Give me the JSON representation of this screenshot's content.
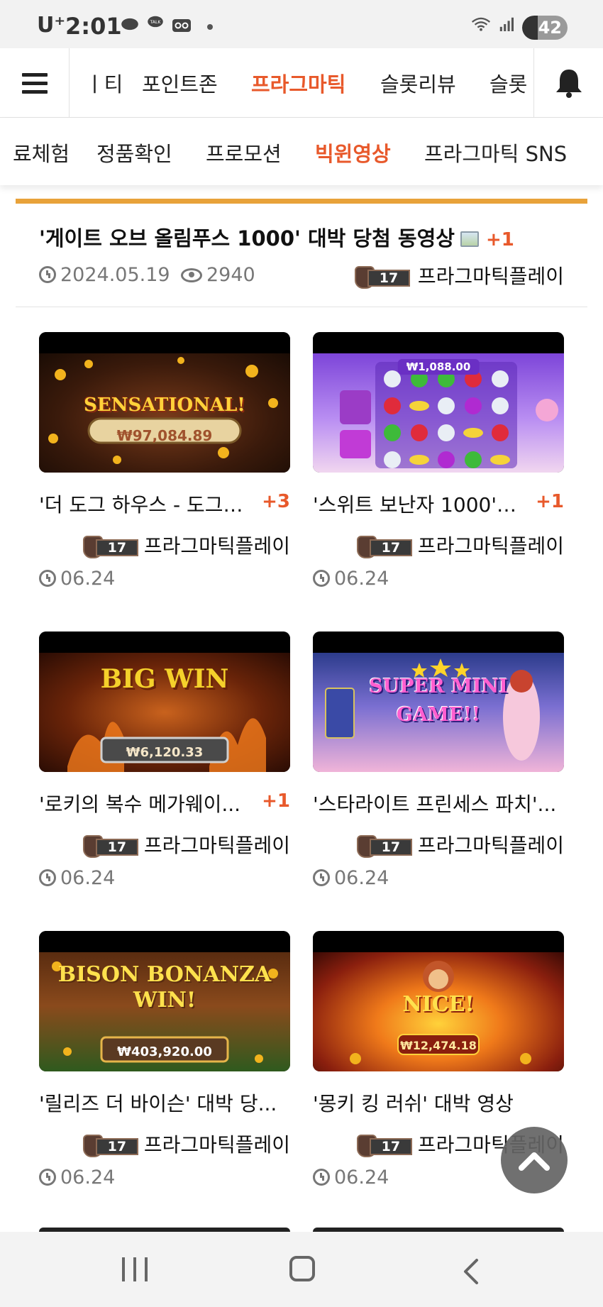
{
  "status_bar": {
    "carrier": "U⁺",
    "time": "2:01",
    "battery": "42",
    "battery_level_percent": 42
  },
  "top_nav": {
    "tabs": [
      {
        "label": "ㅣ티",
        "active": false
      },
      {
        "label": "포인트존",
        "active": false
      },
      {
        "label": "프라그마틱",
        "active": true
      },
      {
        "label": "슬롯리뷰",
        "active": false
      },
      {
        "label": "슬롯",
        "active": false
      }
    ]
  },
  "sub_nav": {
    "tabs": [
      {
        "label": "료체험",
        "active": false
      },
      {
        "label": "정품확인",
        "active": false
      },
      {
        "label": "프로모션",
        "active": false
      },
      {
        "label": "빅윈영상",
        "active": true
      },
      {
        "label": "프라그마틱 SNS",
        "active": false
      }
    ]
  },
  "post": {
    "title": "'게이트 오브 올림푸스 1000' 대박 당첨 동영상",
    "plus": "+1",
    "date": "2024.05.19",
    "views": "2940",
    "level": "17",
    "author": "프라그마틱플레이"
  },
  "cards": [
    {
      "title": "'더 도그 하우스 - 도그 ...",
      "plus": "+3",
      "level": "17",
      "author": "프라그마틱플레이",
      "date": "06.24",
      "banner": "SENSATIONAL!",
      "amount": "₩97,084.89"
    },
    {
      "title": "'스위트 보난자 1000' ...",
      "plus": "+1",
      "level": "17",
      "author": "프라그마틱플레이",
      "date": "06.24",
      "banner": "",
      "amount": "₩1,088.00"
    },
    {
      "title": "'로키의 복수 메가웨이...",
      "plus": "+1",
      "level": "17",
      "author": "프라그마틱플레이",
      "date": "06.24",
      "banner": "BIG WIN",
      "amount": "₩6,120.33"
    },
    {
      "title": "'스타라이트 프린세스 파치'...",
      "plus": "",
      "level": "17",
      "author": "프라그마틱플레이",
      "date": "06.24",
      "banner": "SUPER MINI GAME!!",
      "amount": ""
    },
    {
      "title": "'릴리즈 더 바이슨' 대박 당...",
      "plus": "",
      "level": "17",
      "author": "프라그마틱플레이",
      "date": "06.24",
      "banner": "BISON BONANZA WIN!",
      "amount": "₩403,920.00"
    },
    {
      "title": "'몽키 킹 러쉬' 대박 영상",
      "plus": "",
      "level": "17",
      "author": "프라그마틱플레이",
      "date": "06.24",
      "banner": "NICE!",
      "amount": "₩12,474.18"
    }
  ],
  "colors": {
    "accent": "#e8592b",
    "divider_bar": "#e8a23a",
    "meta_gray": "#777777"
  },
  "icons": [
    "hamburger-menu-icon",
    "bell-icon",
    "clock-icon",
    "eye-icon",
    "image-icon",
    "chevron-up-icon",
    "recent-apps-icon",
    "home-icon",
    "back-icon"
  ]
}
